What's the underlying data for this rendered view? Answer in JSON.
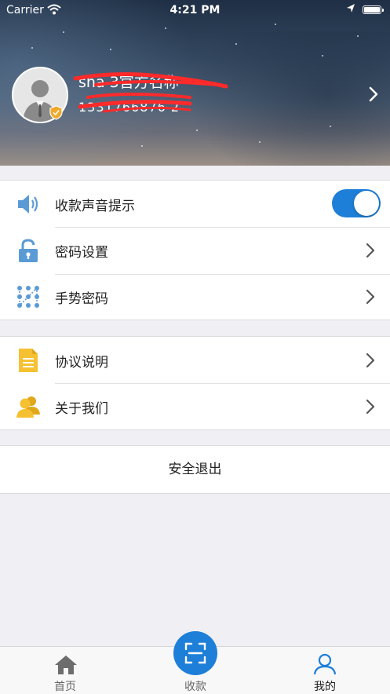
{
  "status_bar": {
    "carrier": "Carrier",
    "time": "4:21 PM"
  },
  "profile": {
    "name": "sha    3官方名称",
    "phone": "1331766876 2"
  },
  "menu_group_1": [
    {
      "label": "收款声音提示",
      "icon": "speaker-icon",
      "toggle_on": true
    },
    {
      "label": "密码设置",
      "icon": "lock-icon"
    },
    {
      "label": "手势密码",
      "icon": "gesture-pattern-icon"
    }
  ],
  "menu_group_2": [
    {
      "label": "协议说明",
      "icon": "document-icon"
    },
    {
      "label": "关于我们",
      "icon": "users-icon"
    }
  ],
  "logout_label": "安全退出",
  "tabbar": {
    "home_label": "首页",
    "scan_label": "收款",
    "me_label": "我的",
    "active": "我的"
  },
  "colors": {
    "accent": "#1d7fd8",
    "icon_blue": "#5b9bd5",
    "icon_yellow": "#f5c132",
    "redaction": "#ff2a2a",
    "tab_inactive": "#666666"
  }
}
